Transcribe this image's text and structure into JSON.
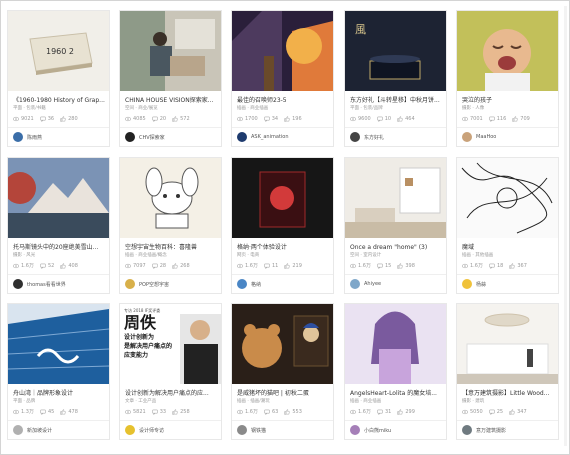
{
  "cards": [
    {
      "title": "《1960-1980 History of Grap...",
      "sub": "平面 · 包装/书籍",
      "views": "9021",
      "comments": "36",
      "likes": "280",
      "author": "陈雨燕",
      "avatar_color": "#3b6ea8"
    },
    {
      "title": "CHINA HOUSE VISION探索家...",
      "sub": "空间 · 商业/展览",
      "views": "4085",
      "comments": "20",
      "likes": "572",
      "author": "CHV探索家",
      "avatar_color": "#222222"
    },
    {
      "title": "最佳的召唤师23-5",
      "sub": "插画 · 商业插画",
      "views": "1700",
      "comments": "34",
      "likes": "196",
      "author": "ASK_animation",
      "avatar_color": "#1e3b6e"
    },
    {
      "title": "东方好礼【斗转星移】中秋月饼...",
      "sub": "平面 · 包装/品牌",
      "views": "9600",
      "comments": "10",
      "likes": "464",
      "author": "东方好礼",
      "avatar_color": "#444444"
    },
    {
      "title": "哭泣的孩子",
      "sub": "摄影 · 人像",
      "views": "7001",
      "comments": "116",
      "likes": "709",
      "author": "MaaHoo",
      "avatar_color": "#c9a27a"
    },
    {
      "title": "托马斯镜头中的20座绝美雪山...",
      "sub": "摄影 · 风光",
      "views": "1.6万",
      "comments": "52",
      "likes": "408",
      "author": "thomas看看世界",
      "avatar_color": "#2f2f2f"
    },
    {
      "title": "空想宇宙生物百科：喜隆兽",
      "sub": "插画 · 商业插画/概念",
      "views": "7097",
      "comments": "28",
      "likes": "268",
      "author": "POP空想宇宙",
      "avatar_color": "#d8b04a"
    },
    {
      "title": "格纳·两个体验设计",
      "sub": "网页 · 电商",
      "views": "1.6万",
      "comments": "11",
      "likes": "219",
      "author": "格纳",
      "avatar_color": "#4a86c5"
    },
    {
      "title": "Once a dream  \"home\"   (3)",
      "sub": "空间 · 室内设计",
      "views": "1.6万",
      "comments": "15",
      "likes": "398",
      "author": "Ahiyee",
      "avatar_color": "#7fa7c9"
    },
    {
      "title": "魔域",
      "sub": "插画 · 其他插画",
      "views": "1.6万",
      "comments": "18",
      "likes": "367",
      "author": "杨蒜",
      "avatar_color": "#f0c23a"
    },
    {
      "title": "舟山湾｜品牌形象设计",
      "sub": "平面 · 品牌",
      "views": "1.3万",
      "comments": "45",
      "likes": "478",
      "author": "新加坡设计",
      "avatar_color": "#b0b0b0"
    },
    {
      "title": "设计创新为解决用户痛点的应...",
      "sub": "文章 · 工业产品",
      "views": "5821",
      "comments": "33",
      "likes": "258",
      "author": "设计师专访",
      "avatar_color": "#e6c12e"
    },
    {
      "title": "是威猪坏的猫吧 | 初秋二蛋",
      "sub": "插画 · 插画/潮玩",
      "views": "1.6万",
      "comments": "63",
      "likes": "553",
      "author": "钢铁猫",
      "avatar_color": "#8a8a8a"
    },
    {
      "title": "AngelsHeart-Lolita 的魔女培...",
      "sub": "插画 · 商业插画",
      "views": "1.6万",
      "comments": "31",
      "likes": "299",
      "author": "小白熊miku",
      "avatar_color": "#a57fb8"
    },
    {
      "title": "【意万建筑摄影】Little Wood...",
      "sub": "摄影 · 建筑",
      "views": "5050",
      "comments": "25",
      "likes": "347",
      "author": "意万建筑摄影",
      "avatar_color": "#6f7a80"
    }
  ],
  "images": {
    "book_label": "1960 2"
  },
  "poster": {
    "kicker": "专访 2018 IF奖评委",
    "big": "周佚",
    "line1": "设计创新为",
    "line2": "是解决用户痛点的",
    "line3": "应变能力"
  }
}
